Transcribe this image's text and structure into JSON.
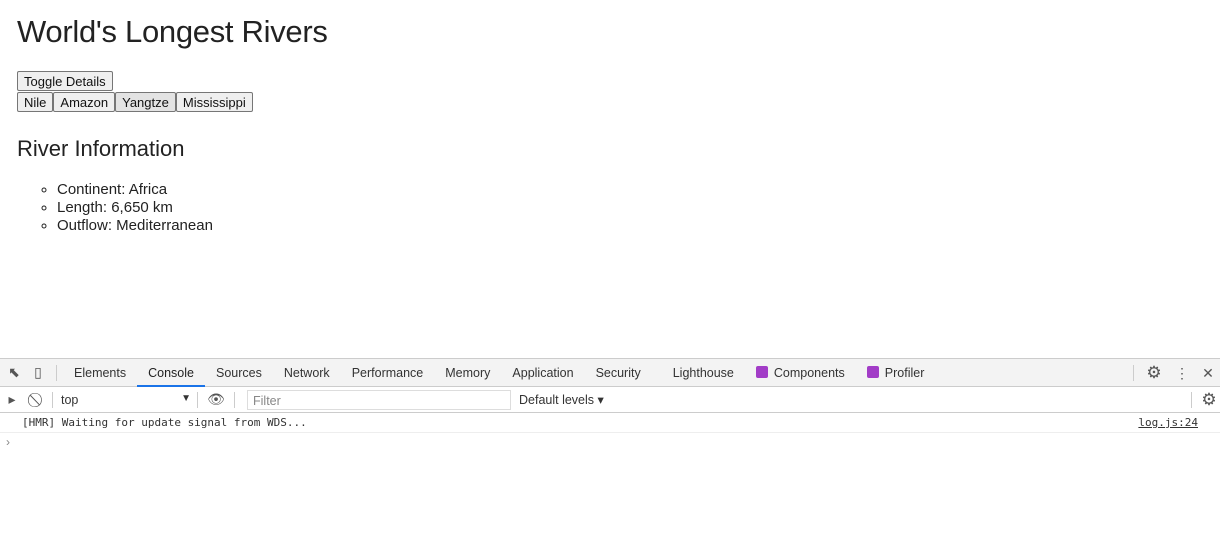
{
  "page": {
    "title": "World's Longest Rivers",
    "toggle_label": "Toggle Details",
    "rivers": [
      "Nile",
      "Amazon",
      "Yangtze",
      "Mississippi"
    ],
    "info_heading": "River Information",
    "details": [
      "Continent: Africa",
      "Length: 6,650 km",
      "Outflow: Mediterranean"
    ]
  },
  "devtools": {
    "tabs": [
      "Elements",
      "Console",
      "Sources",
      "Network",
      "Performance",
      "Memory",
      "Application",
      "Security",
      "Lighthouse",
      "Components",
      "Profiler"
    ],
    "active_tab": "Console",
    "context": "top",
    "filter_placeholder": "Filter",
    "levels": "Default levels ▾",
    "messages": [
      {
        "text": "[HMR] Waiting for update signal from WDS...",
        "source": "log.js:24"
      }
    ],
    "prompt": "›",
    "accent": "#1a73e8"
  }
}
